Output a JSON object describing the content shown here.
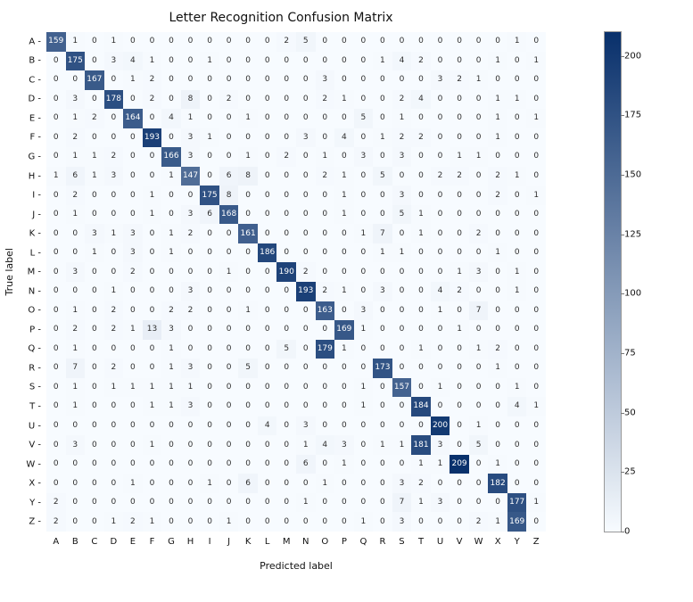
{
  "chart_data": {
    "type": "heatmap",
    "title": "Letter Recognition Confusion Matrix",
    "xlabel": "Predicted label",
    "ylabel": "True label",
    "categories": [
      "A",
      "B",
      "C",
      "D",
      "E",
      "F",
      "G",
      "H",
      "I",
      "J",
      "K",
      "L",
      "M",
      "N",
      "O",
      "P",
      "Q",
      "R",
      "S",
      "T",
      "U",
      "V",
      "W",
      "X",
      "Y",
      "Z"
    ],
    "colorbar_ticks": [
      0,
      25,
      50,
      75,
      100,
      125,
      150,
      175,
      200
    ],
    "vmax": 210,
    "matrix": [
      [
        159,
        1,
        0,
        1,
        0,
        0,
        0,
        0,
        0,
        0,
        0,
        0,
        2,
        5,
        0,
        0,
        0,
        0,
        0,
        0,
        0,
        0,
        0,
        0,
        1,
        0
      ],
      [
        0,
        175,
        0,
        3,
        4,
        1,
        0,
        0,
        1,
        0,
        0,
        0,
        0,
        0,
        0,
        0,
        0,
        1,
        4,
        2,
        0,
        0,
        0,
        1,
        0,
        1
      ],
      [
        0,
        0,
        167,
        0,
        1,
        2,
        0,
        0,
        0,
        0,
        0,
        0,
        0,
        0,
        3,
        0,
        0,
        0,
        0,
        0,
        3,
        2,
        1,
        0,
        0,
        0
      ],
      [
        0,
        3,
        0,
        178,
        0,
        2,
        0,
        8,
        0,
        2,
        0,
        0,
        0,
        0,
        2,
        1,
        0,
        0,
        2,
        4,
        0,
        0,
        0,
        1,
        1,
        0
      ],
      [
        0,
        1,
        2,
        0,
        164,
        0,
        4,
        1,
        0,
        0,
        1,
        0,
        0,
        0,
        0,
        0,
        5,
        0,
        1,
        0,
        0,
        0,
        0,
        1,
        0,
        1
      ],
      [
        0,
        2,
        0,
        0,
        0,
        193,
        0,
        3,
        1,
        0,
        0,
        0,
        0,
        3,
        0,
        4,
        0,
        1,
        2,
        2,
        0,
        0,
        0,
        1,
        0,
        0
      ],
      [
        0,
        1,
        1,
        2,
        0,
        0,
        166,
        3,
        0,
        0,
        1,
        0,
        2,
        0,
        1,
        0,
        3,
        0,
        3,
        0,
        0,
        1,
        1,
        0,
        0,
        0
      ],
      [
        1,
        6,
        1,
        3,
        0,
        0,
        1,
        147,
        0,
        6,
        8,
        0,
        0,
        0,
        2,
        1,
        0,
        5,
        0,
        0,
        2,
        2,
        0,
        2,
        1,
        0
      ],
      [
        0,
        2,
        0,
        0,
        0,
        1,
        0,
        0,
        175,
        8,
        0,
        0,
        0,
        0,
        0,
        1,
        0,
        0,
        3,
        0,
        0,
        0,
        0,
        2,
        0,
        1
      ],
      [
        0,
        1,
        0,
        0,
        0,
        1,
        0,
        3,
        6,
        168,
        0,
        0,
        0,
        0,
        0,
        1,
        0,
        0,
        5,
        1,
        0,
        0,
        0,
        0,
        0,
        0
      ],
      [
        0,
        0,
        3,
        1,
        3,
        0,
        1,
        2,
        0,
        0,
        161,
        0,
        0,
        0,
        0,
        0,
        1,
        7,
        0,
        1,
        0,
        0,
        2,
        0,
        0,
        0
      ],
      [
        0,
        0,
        1,
        0,
        3,
        0,
        1,
        0,
        0,
        0,
        0,
        186,
        0,
        0,
        0,
        0,
        0,
        1,
        1,
        0,
        0,
        0,
        0,
        1,
        0,
        0
      ],
      [
        0,
        3,
        0,
        0,
        2,
        0,
        0,
        0,
        0,
        1,
        0,
        0,
        190,
        2,
        0,
        0,
        0,
        0,
        0,
        0,
        0,
        1,
        3,
        0,
        1,
        0
      ],
      [
        0,
        0,
        0,
        1,
        0,
        0,
        0,
        3,
        0,
        0,
        0,
        0,
        0,
        193,
        2,
        1,
        0,
        3,
        0,
        0,
        4,
        2,
        0,
        0,
        1,
        0
      ],
      [
        0,
        1,
        0,
        2,
        0,
        0,
        2,
        2,
        0,
        0,
        1,
        0,
        0,
        0,
        163,
        0,
        3,
        0,
        0,
        0,
        1,
        0,
        7,
        0,
        0,
        0
      ],
      [
        0,
        2,
        0,
        2,
        1,
        13,
        3,
        0,
        0,
        0,
        0,
        0,
        0,
        0,
        0,
        169,
        1,
        0,
        0,
        0,
        0,
        1,
        0,
        0,
        0,
        0
      ],
      [
        0,
        1,
        0,
        0,
        0,
        0,
        1,
        0,
        0,
        0,
        0,
        0,
        5,
        0,
        179,
        1,
        0,
        0,
        0,
        1,
        0,
        0,
        1,
        2,
        0,
        0
      ],
      [
        0,
        7,
        0,
        2,
        0,
        0,
        1,
        3,
        0,
        0,
        5,
        0,
        0,
        0,
        0,
        0,
        0,
        173,
        0,
        0,
        0,
        0,
        0,
        1,
        0,
        0
      ],
      [
        0,
        1,
        0,
        1,
        1,
        1,
        1,
        1,
        0,
        0,
        0,
        0,
        0,
        0,
        0,
        0,
        1,
        0,
        157,
        0,
        1,
        0,
        0,
        0,
        1,
        0
      ],
      [
        0,
        1,
        0,
        0,
        0,
        1,
        1,
        3,
        0,
        0,
        0,
        0,
        0,
        0,
        0,
        0,
        1,
        0,
        0,
        184,
        0,
        0,
        0,
        0,
        4,
        1
      ],
      [
        0,
        0,
        0,
        0,
        0,
        0,
        0,
        0,
        0,
        0,
        0,
        4,
        0,
        3,
        0,
        0,
        0,
        0,
        0,
        0,
        200,
        0,
        1,
        0,
        0,
        0
      ],
      [
        0,
        3,
        0,
        0,
        0,
        1,
        0,
        0,
        0,
        0,
        0,
        0,
        0,
        1,
        4,
        3,
        0,
        1,
        1,
        181,
        3,
        0,
        5,
        0,
        0,
        0
      ],
      [
        0,
        0,
        0,
        0,
        0,
        0,
        0,
        0,
        0,
        0,
        0,
        0,
        0,
        6,
        0,
        1,
        0,
        0,
        0,
        1,
        1,
        209,
        0,
        1,
        0,
        0
      ],
      [
        0,
        0,
        0,
        0,
        1,
        0,
        0,
        0,
        1,
        0,
        6,
        0,
        0,
        0,
        1,
        0,
        0,
        0,
        3,
        2,
        0,
        0,
        0,
        182,
        0,
        0
      ],
      [
        2,
        0,
        0,
        0,
        0,
        0,
        0,
        0,
        0,
        0,
        0,
        0,
        0,
        1,
        0,
        0,
        0,
        0,
        7,
        1,
        3,
        0,
        0,
        0,
        177,
        1
      ],
      [
        2,
        0,
        0,
        1,
        2,
        1,
        0,
        0,
        0,
        1,
        0,
        0,
        0,
        0,
        0,
        0,
        1,
        0,
        3,
        0,
        0,
        0,
        2,
        1,
        169,
        0
      ]
    ]
  }
}
